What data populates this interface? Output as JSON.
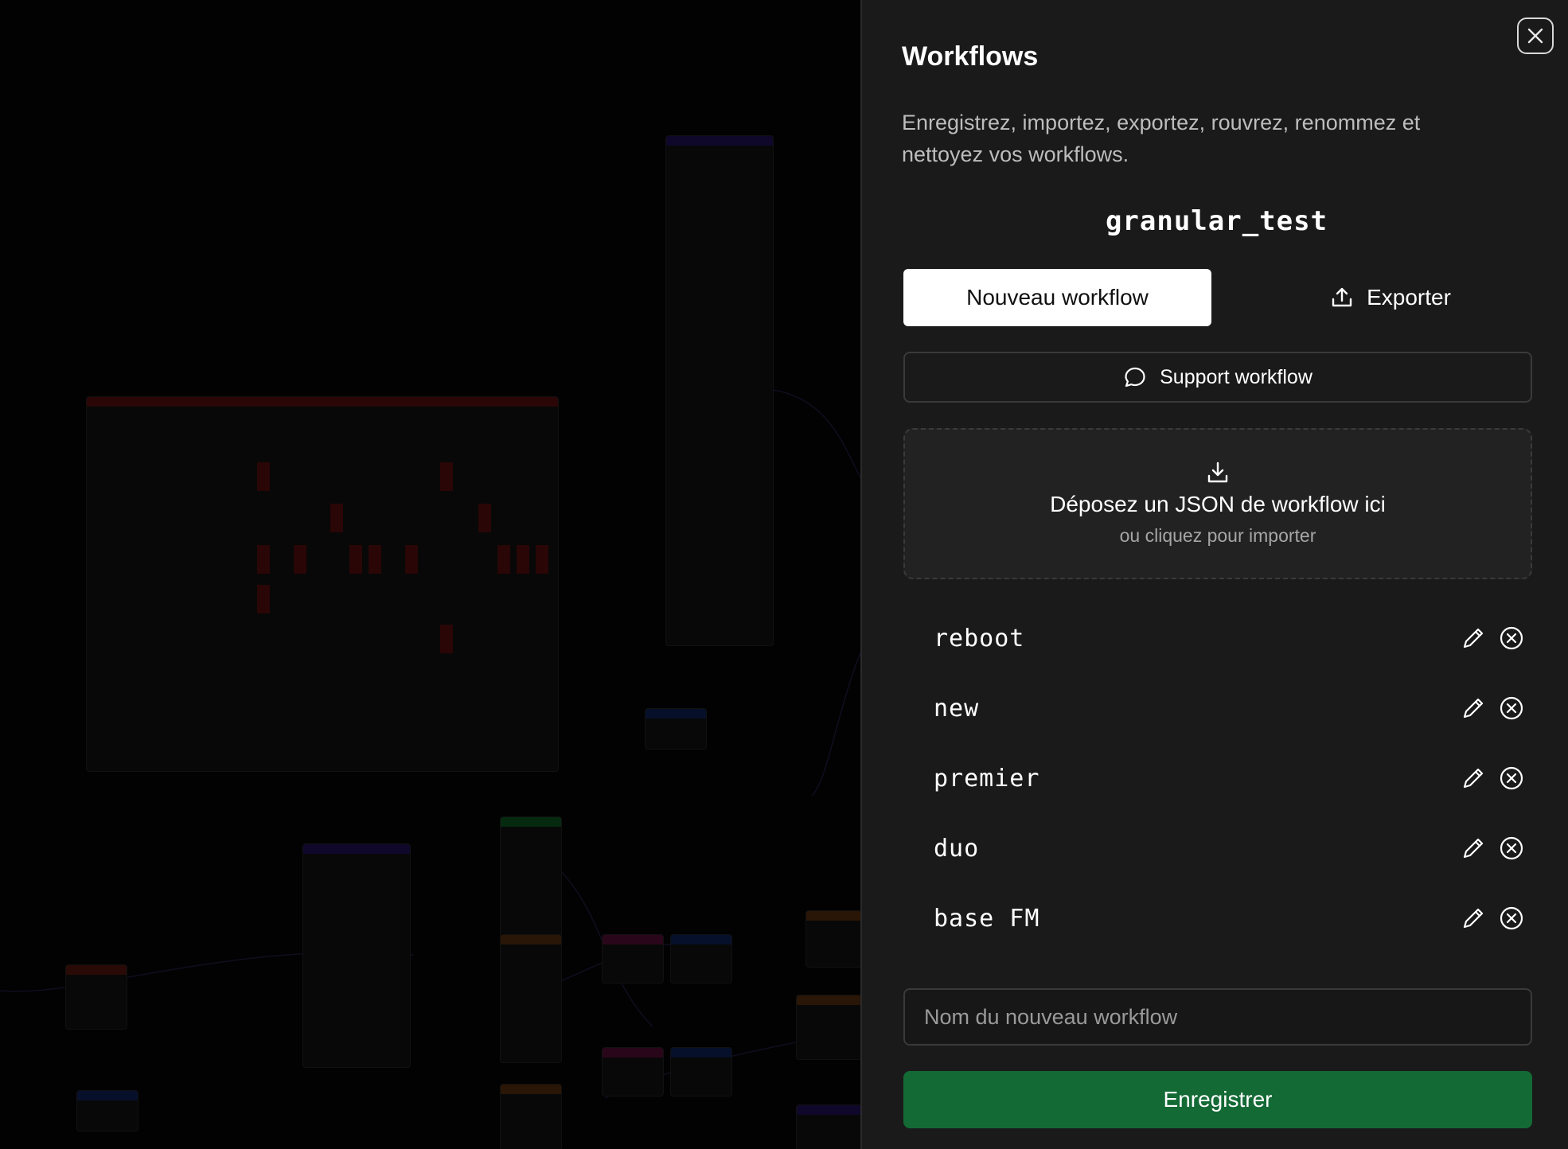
{
  "panel": {
    "title": "Workflows",
    "description": "Enregistrez, importez, exportez, rouvrez, renommez et nettoyez vos workflows.",
    "current_workflow": "granular_test",
    "new_button": "Nouveau workflow",
    "export_button": "Exporter",
    "support_button": "Support workflow",
    "dropzone": {
      "main": "Déposez un JSON de workflow ici",
      "sub": "ou cliquez pour importer"
    },
    "workflows": [
      {
        "name": "reboot"
      },
      {
        "name": "new"
      },
      {
        "name": "premier"
      },
      {
        "name": "duo"
      },
      {
        "name": "base FM"
      }
    ],
    "name_input": {
      "placeholder": "Nom du nouveau workflow",
      "value": ""
    },
    "save_button": "Enregistrer"
  },
  "icons": {
    "close": "close-icon",
    "export": "upload-icon",
    "support": "chat-bubble-icon",
    "dropzone": "download-icon",
    "edit": "pencil-icon",
    "delete": "circle-x-icon"
  },
  "colors": {
    "panel_bg": "#1a1a1a",
    "primary_button_bg": "#ffffff",
    "save_button_bg": "#136a35",
    "text": "#ffffff",
    "muted_text": "#bdbdbd"
  }
}
